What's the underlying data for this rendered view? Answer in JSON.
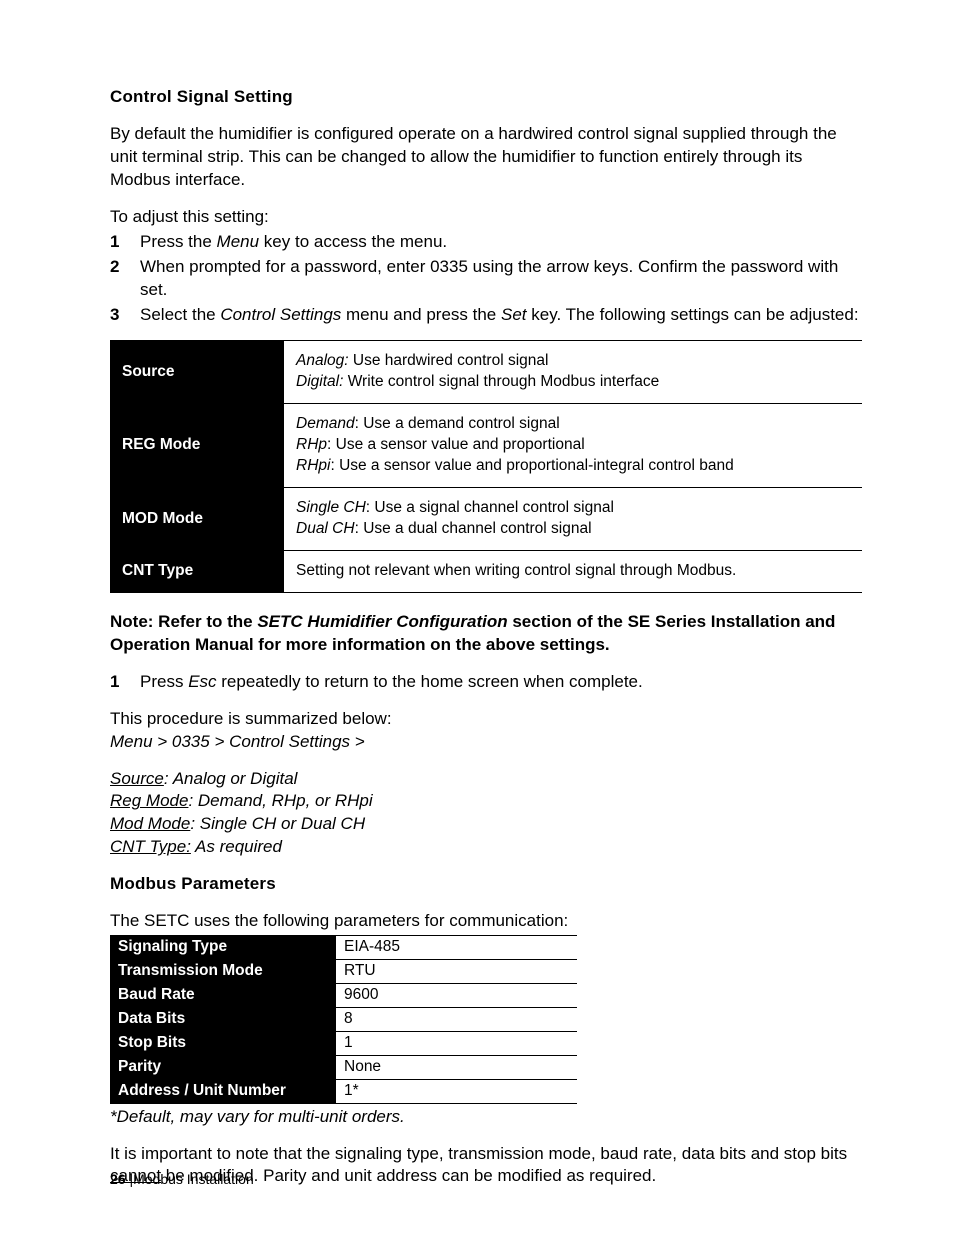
{
  "headings": {
    "control_signal": "Control Signal Setting",
    "modbus_params": "Modbus Parameters"
  },
  "intro": "By default the humidifier is configured operate on a hardwired control signal supplied through the unit terminal strip.  This can be changed to allow the humidifier to function entirely through its Modbus interface.",
  "adjust_lead": "To adjust this setting:",
  "steps1": {
    "n1": "1",
    "t1a": "Press the ",
    "t1b": "Menu",
    "t1c": " key to access the menu.",
    "n2": "2",
    "t2": "When prompted for a password, enter 0335 using the arrow keys.  Confirm the password with set.",
    "n3": "3",
    "t3a": "Select the ",
    "t3b": "Control Settings",
    "t3c": " menu and press the ",
    "t3d": "Set",
    "t3e": " key.  The following settings can be adjusted:"
  },
  "settings_table": [
    {
      "label": "Source",
      "options": [
        {
          "name": "Analog:",
          "desc": "  Use hardwired control signal"
        },
        {
          "name": "Digital:",
          "desc": " Write control signal through Modbus interface"
        }
      ]
    },
    {
      "label": "REG Mode",
      "options": [
        {
          "name": "Demand",
          "desc": ": Use a demand control signal"
        },
        {
          "name": "RHp",
          "desc": ": Use a sensor value and proportional"
        },
        {
          "name": "RHpi",
          "desc": ": Use a sensor value and proportional-integral control band"
        }
      ]
    },
    {
      "label": "MOD Mode",
      "options": [
        {
          "name": "Single CH",
          "desc": ": Use a signal channel control signal"
        },
        {
          "name": "Dual CH",
          "desc": ": Use a dual channel control signal"
        }
      ]
    },
    {
      "label": "CNT Type",
      "options": [
        {
          "name": "",
          "desc": "Setting not relevant when writing control signal through Modbus."
        }
      ]
    }
  ],
  "note": {
    "a": "Note: Refer to the ",
    "b": "SETC Humidifier Configuration",
    "c": " section of the SE Series Installation and Operation Manual for more information on the above settings."
  },
  "steps2": {
    "n1": "1",
    "t1a": "Press ",
    "t1b": "Esc",
    "t1c": " repeatedly to return to the home screen when complete."
  },
  "summary": {
    "lead": "This procedure is summarized below:",
    "path": "Menu > 0335 > Control Settings >",
    "lines": [
      {
        "u": "Source",
        "rest": ": Analog or Digital"
      },
      {
        "u": "Reg Mode",
        "rest": ": Demand, RHp, or RHpi"
      },
      {
        "u": "Mod Mode",
        "rest": ": Single CH or Dual CH"
      },
      {
        "u": "CNT Type:",
        "rest": " As required"
      }
    ]
  },
  "params_lead": "The SETC uses the following parameters for communication:",
  "params_table": [
    {
      "label": "Signaling Type",
      "value": "EIA-485"
    },
    {
      "label": "Transmission Mode",
      "value": "RTU"
    },
    {
      "label": "Baud Rate",
      "value": "9600"
    },
    {
      "label": "Data Bits",
      "value": "8"
    },
    {
      "label": "Stop Bits",
      "value": "1"
    },
    {
      "label": "Parity",
      "value": "None"
    },
    {
      "label": "Address / Unit Number",
      "value": "1*"
    }
  ],
  "params_footnote": "*Default, may vary for multi-unit orders.",
  "important": {
    "a": "It is important to note that the signaling type, transmission mode, baud rate, data bits and stop bits ",
    "b": "cannot",
    "c": " be modified.  Parity and unit address can be modified as required."
  },
  "footer": {
    "page": "26",
    "sep": " |",
    "section": "Modbus Installation"
  }
}
